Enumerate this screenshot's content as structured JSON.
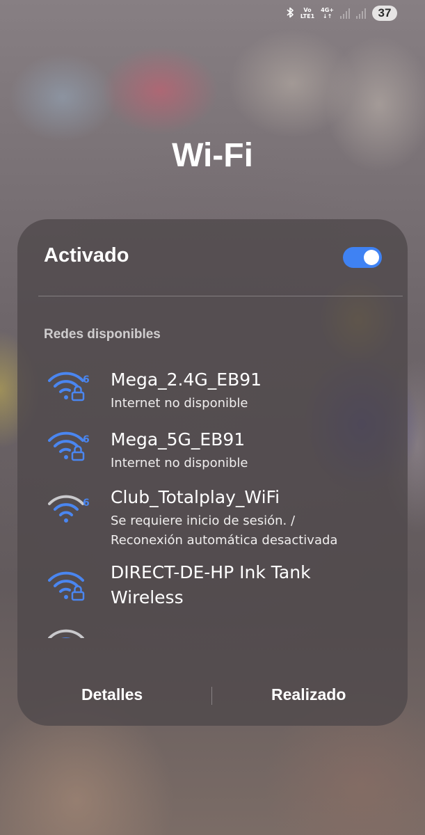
{
  "status_bar": {
    "bluetooth_icon": "bluetooth-icon",
    "volte_top": "Vo",
    "volte_bottom": "LTE1",
    "network_type": "4G+",
    "network_arrows": "↓↑",
    "battery": "37"
  },
  "title": "Wi-Fi",
  "wifi_toggle": {
    "label": "Activado",
    "state": "on"
  },
  "section_label": "Redes disponibles",
  "networks": [
    {
      "name": "Mega_2.4G_EB91",
      "status": "Internet no disponible",
      "secured": true,
      "wifi6": true
    },
    {
      "name": "Mega_5G_EB91",
      "status": "Internet no disponible",
      "secured": true,
      "wifi6": true
    },
    {
      "name": "Club_Totalplay_WiFi",
      "status_line1": "Se requiere inicio de sesión. /",
      "status_line2": "Reconexión automática desactivada",
      "secured": false,
      "wifi6": true
    },
    {
      "name_line1": "DIRECT-DE-HP Ink Tank",
      "name_line2": "Wireless",
      "secured": true,
      "wifi6": false
    }
  ],
  "footer": {
    "details": "Detalles",
    "done": "Realizado"
  },
  "colors": {
    "accent": "#3f82f3",
    "wifi_blue": "#4a86f0",
    "wifi_gray": "#c9c9cc",
    "panel": "#4e484a"
  }
}
